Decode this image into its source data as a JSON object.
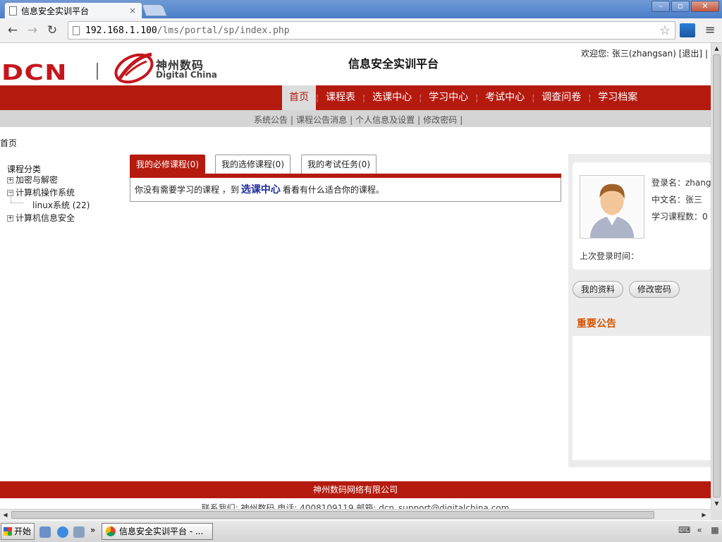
{
  "browser": {
    "tab_title": "信息安全实训平台",
    "tab_close": "×",
    "url_host": "192.168.1.100",
    "url_path": "/lms/portal/sp/index.php",
    "window_buttons": [
      "–",
      "▫",
      "✕"
    ]
  },
  "header": {
    "logo_text": "DCN",
    "logo_cn": "神州数码",
    "logo_en": "Digital China",
    "site_title": "信息安全实训平台",
    "welcome_prefix": "欢迎您: 张三(zhangsan)",
    "logout": "[退出]",
    "trailing_pipe": "|"
  },
  "mainnav": {
    "items": [
      "首页",
      "课程表",
      "选课中心",
      "学习中心",
      "考试中心",
      "调查问卷",
      "学习档案"
    ],
    "active_index": 0,
    "separator": "¦"
  },
  "subnav": {
    "items": [
      "系统公告",
      "课程公告消息",
      "个人信息及设置",
      "修改密码"
    ],
    "separator": "|"
  },
  "breadcrumb": "首页",
  "tree": {
    "root": "课程分类",
    "nodes": [
      {
        "label": "加密与解密",
        "toggle": "+"
      },
      {
        "label": "计算机操作系统",
        "toggle": "−"
      },
      {
        "label": "linux系统 (22)",
        "toggle": ""
      },
      {
        "label": "计算机信息安全",
        "toggle": "+"
      }
    ]
  },
  "course_tabs": {
    "tabs": [
      "我的必修课程(0)",
      "我的选修课程(0)",
      "我的考试任务(0)"
    ],
    "active_index": 0,
    "message_before": "你没有需要学习的课程 ，到",
    "message_link": "选课中心",
    "message_after": "看看有什么适合你的课程。"
  },
  "user_card": {
    "login_name": "登录名：zhangsan",
    "chinese_name": "中文名：张三",
    "course_count": "学习课程数：0",
    "last_login": "上次登录时间："
  },
  "right_buttons": {
    "profile": "我的资料",
    "change_password": "修改密码"
  },
  "notice": {
    "title": "重要公告"
  },
  "footer": {
    "company": "神州数码网络有限公司",
    "contact": "联系我们: 神州数码  电话: 4008109119  邮箱: dcn_support@digitalchina.com"
  },
  "taskbar": {
    "start": "开始",
    "more": "»",
    "task_title": "信息安全实训平台 - ...",
    "tray_more": "«"
  },
  "colors": {
    "brand_red": "#b51a0f",
    "link_blue": "#1e2a9e",
    "notice_orange": "#d35400"
  }
}
